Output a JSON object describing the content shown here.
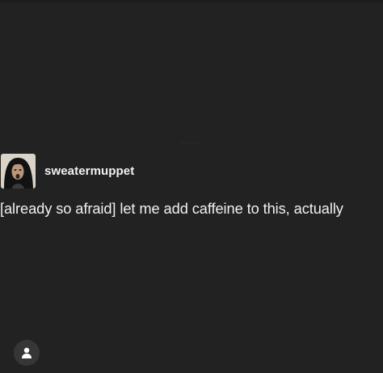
{
  "post": {
    "username": "sweatermuppet",
    "text": "[already so afraid] let me add caffeine to this, actually"
  },
  "icons": {
    "avatar": "avatar-image",
    "profile": "user-icon"
  },
  "colors": {
    "background": "#222222",
    "text": "#f0f0f0",
    "button": "#363636"
  }
}
